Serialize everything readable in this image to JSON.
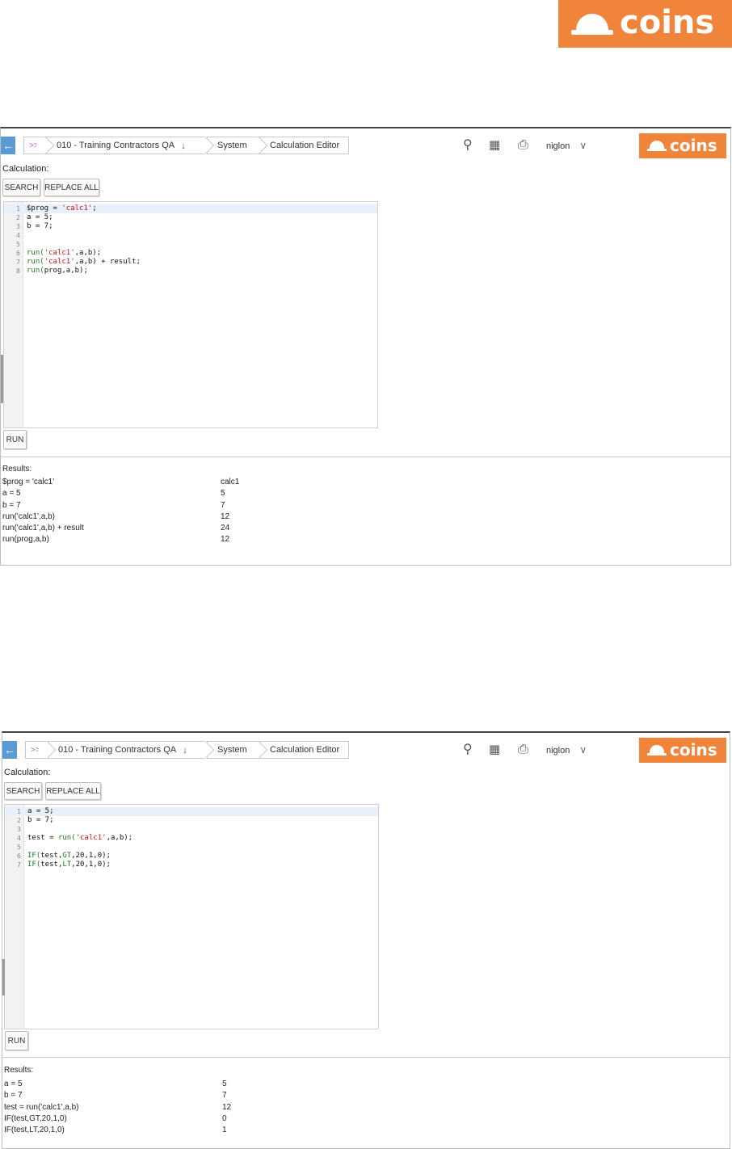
{
  "brand": {
    "logo_text": "coins",
    "color": "#f0843a"
  },
  "topbar": {
    "home_crumb": ">>>",
    "company_crumb": "010 - Training Contractors QA",
    "company_arrow": "↓",
    "system_crumb": "System",
    "page_crumb": "Calculation Editor",
    "user": "niglon",
    "user_chevron": "∨",
    "search_icon": "⚲",
    "apps_icon": "▦",
    "print_icon": "⎙"
  },
  "labels": {
    "calculation": "Calculation:",
    "search_button": "SEARCH",
    "replace_all_button": "REPLACE ALL",
    "run_button": "RUN",
    "results": "Results:"
  },
  "example1": {
    "code_lines": [
      {
        "n": "1",
        "html": "$prog = <span class='s'>'calc1'</span>;"
      },
      {
        "n": "2",
        "html": "a = 5;"
      },
      {
        "n": "3",
        "html": "b = 7;"
      },
      {
        "n": "4",
        "html": ""
      },
      {
        "n": "5",
        "html": ""
      },
      {
        "n": "6",
        "html": "<span class='f'>run(</span><span class='s'>'calc1'</span>,a,b);"
      },
      {
        "n": "7",
        "html": "<span class='f'>run(</span><span class='s'>'calc1'</span>,a,b) + result;"
      },
      {
        "n": "8",
        "html": "<span class='f'>run(</span>prog,a,b);"
      }
    ],
    "results": [
      {
        "expr": "$prog = 'calc1'",
        "val": "calc1"
      },
      {
        "expr": "a = 5",
        "val": "5"
      },
      {
        "expr": "b = 7",
        "val": "7"
      },
      {
        "expr": "run('calc1',a,b)",
        "val": "12"
      },
      {
        "expr": "run('calc1',a,b) + result",
        "val": "24"
      },
      {
        "expr": "run(prog,a,b)",
        "val": "12"
      }
    ]
  },
  "example2": {
    "code_lines": [
      {
        "n": "1",
        "html": "a = 5;"
      },
      {
        "n": "2",
        "html": "b = 7;"
      },
      {
        "n": "3",
        "html": ""
      },
      {
        "n": "4",
        "html": "test = <span class='f'>run(</span><span class='s'>'calc1'</span>,a,b);"
      },
      {
        "n": "5",
        "html": ""
      },
      {
        "n": "6",
        "html": "<span class='f'>IF(</span>test,<span class='f'>GT</span>,20,1,0);"
      },
      {
        "n": "7",
        "html": "<span class='f'>IF(</span>test,<span class='f'>LT</span>,20,1,0);"
      }
    ],
    "results": [
      {
        "expr": "a = 5",
        "val": "5"
      },
      {
        "expr": "b = 7",
        "val": "7"
      },
      {
        "expr": "test = run('calc1',a,b)",
        "val": "12"
      },
      {
        "expr": "IF(test,GT,20,1,0)",
        "val": "0"
      },
      {
        "expr": "IF(test,LT,20,1,0)",
        "val": "1"
      }
    ]
  }
}
